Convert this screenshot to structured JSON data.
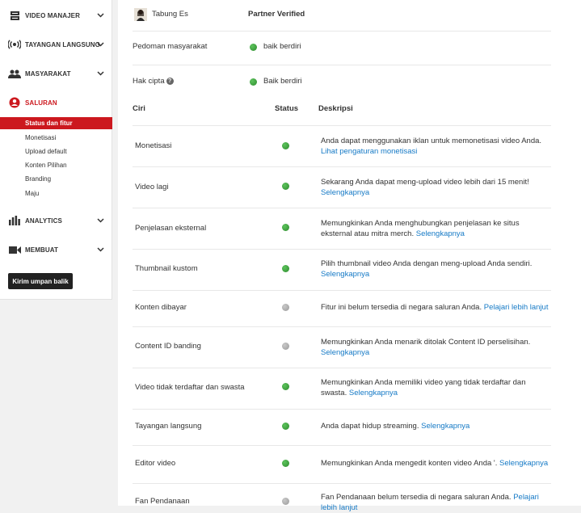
{
  "sidebar": {
    "sections": [
      {
        "label": "VIDEO MANAJER",
        "icon": "video-manager-icon"
      },
      {
        "label": "TAYANGAN LANGSUNG",
        "icon": "live-broadcast-icon"
      },
      {
        "label": "MASYARAKAT",
        "icon": "community-icon"
      },
      {
        "label": "SALURAN",
        "icon": "channel-icon"
      },
      {
        "label": "ANALYTICS",
        "icon": "analytics-icon"
      },
      {
        "label": "MEMBUAT",
        "icon": "create-icon"
      }
    ],
    "channel_items": [
      "Status dan fitur",
      "Monetisasi",
      "Upload default",
      "Konten Pilihan",
      "Branding",
      "Maju"
    ],
    "selected_item": "Status dan fitur",
    "feedback_label": "Kirim umpan balik"
  },
  "account": {
    "name": "Tabung Es",
    "status": "Partner Verified"
  },
  "standing": [
    {
      "label": "Pedoman masyarakat",
      "status_text": "baik berdiri",
      "status_color": "#3a9d3a"
    },
    {
      "label": "Hak cipta",
      "status_text": "Baik berdiri",
      "status_color": "#3a9d3a"
    }
  ],
  "table": {
    "headers": {
      "feature": "Ciri",
      "status": "Status",
      "description": "Deskripsi"
    },
    "rows": [
      {
        "feature": "Monetisasi",
        "enabled": true,
        "desc": "Anda dapat menggunakan iklan untuk memonetisasi video Anda.",
        "link": "Lihat pengaturan monetisasi"
      },
      {
        "feature": "Video lagi",
        "enabled": true,
        "desc": "Sekarang Anda dapat meng-upload video lebih dari 15 menit!",
        "link": "Selengkapnya"
      },
      {
        "feature": "Penjelasan eksternal",
        "enabled": true,
        "desc": "Memungkinkan Anda menghubungkan penjelasan ke situs eksternal atau mitra merch.",
        "link": "Selengkapnya"
      },
      {
        "feature": "Thumbnail kustom",
        "enabled": true,
        "desc": "Pilih thumbnail video Anda dengan meng-upload Anda sendiri.",
        "link": "Selengkapnya"
      },
      {
        "feature": "Konten dibayar",
        "enabled": false,
        "desc": "Fitur ini belum tersedia di negara saluran Anda.",
        "link": "Pelajari lebih lanjut"
      },
      {
        "feature": "Content ID banding",
        "enabled": false,
        "desc": "Memungkinkan Anda menarik ditolak Content ID perselisihan.",
        "link": "Selengkapnya"
      },
      {
        "feature": "Video tidak terdaftar dan swasta",
        "enabled": true,
        "desc": "Memungkinkan Anda memiliki video yang tidak terdaftar dan swasta.",
        "link": "Selengkapnya"
      },
      {
        "feature": "Tayangan langsung",
        "enabled": true,
        "desc": "Anda dapat hidup streaming.",
        "link": "Selengkapnya"
      },
      {
        "feature": "Editor video",
        "enabled": true,
        "desc": "Memungkinkan Anda mengedit konten video Anda '.",
        "link": "Selengkapnya"
      },
      {
        "feature": "Fan Pendanaan",
        "enabled": false,
        "desc": "Fan Pendanaan belum tersedia di negara saluran Anda.",
        "link": "Pelajari lebih lanjut"
      }
    ]
  },
  "colors": {
    "accent": "#cc181e",
    "link": "#167ac6",
    "enabled": "#3a9d3a",
    "disabled": "#a8a8a8"
  }
}
